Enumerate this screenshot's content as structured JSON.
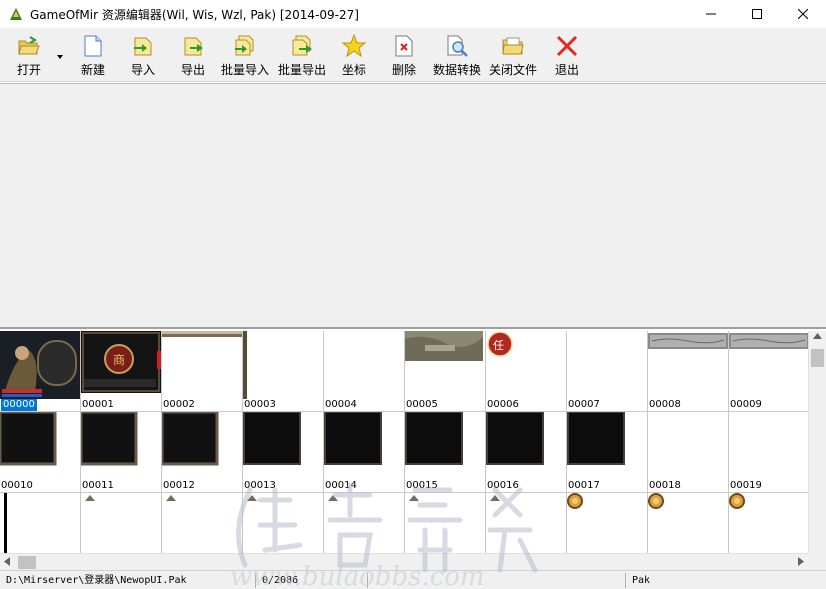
{
  "window": {
    "title": "GameOfMir 资源编辑器(Wil, Wis, Wzl, Pak) [2014-09-27]",
    "icon": "app-icon"
  },
  "toolbar": {
    "items": [
      {
        "label": "打开",
        "icon": "open-folder-icon"
      },
      {
        "label": "新建",
        "icon": "new-file-icon"
      },
      {
        "label": "导入",
        "icon": "import-icon"
      },
      {
        "label": "导出",
        "icon": "export-icon"
      },
      {
        "label": "批量导入",
        "icon": "batch-import-icon"
      },
      {
        "label": "批量导出",
        "icon": "batch-export-icon"
      },
      {
        "label": "坐标",
        "icon": "star-icon"
      },
      {
        "label": "删除",
        "icon": "delete-icon"
      },
      {
        "label": "数据转换",
        "icon": "convert-icon"
      },
      {
        "label": "关闭文件",
        "icon": "close-file-icon"
      },
      {
        "label": "退出",
        "icon": "exit-icon"
      }
    ]
  },
  "grid": {
    "selected_index": 0,
    "cells": [
      "00000",
      "00001",
      "00002",
      "00003",
      "00004",
      "00005",
      "00006",
      "00007",
      "00008",
      "00009",
      "00010",
      "00011",
      "00012",
      "00013",
      "00014",
      "00015",
      "00016",
      "00017",
      "00018",
      "00019",
      "",
      "",
      "",
      "",
      "",
      "",
      "",
      "",
      "",
      ""
    ]
  },
  "statusbar": {
    "path": "D:\\Mirserver\\登录器\\NewopUI.Pak",
    "count": "0/2086",
    "blank": "",
    "type": "Pak"
  },
  "colors": {
    "selection": "#0078d7",
    "toolbar_bg": "#f0f0f0",
    "grid_line": "#c8c8c8"
  }
}
